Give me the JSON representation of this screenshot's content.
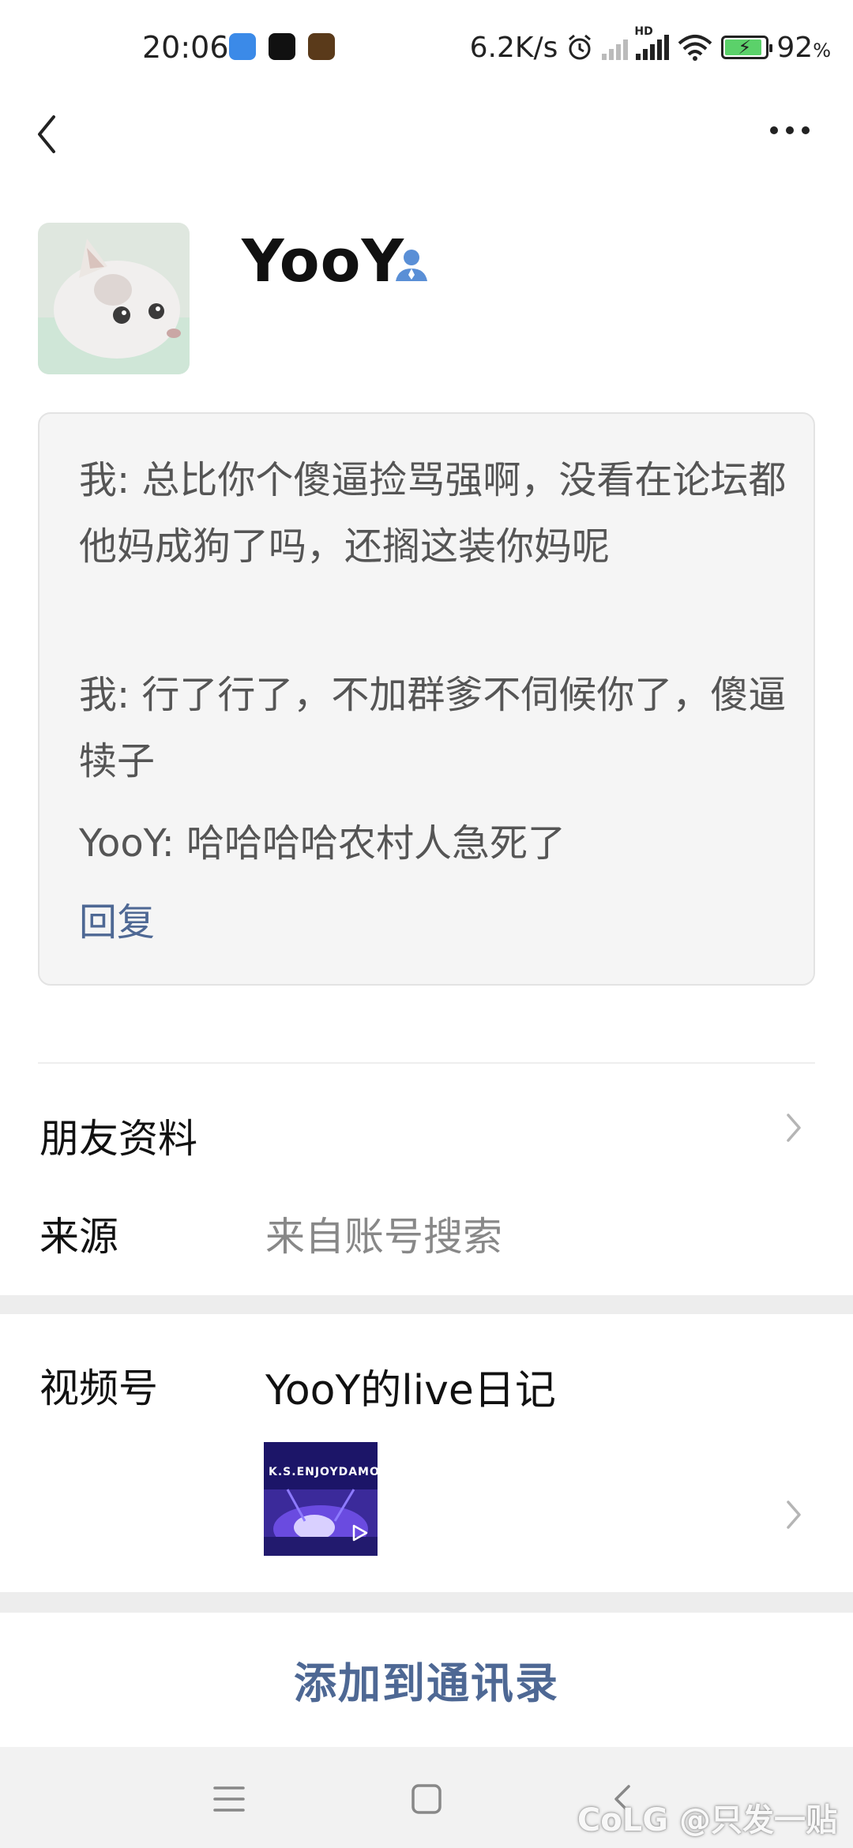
{
  "status_bar": {
    "time": "20:06",
    "network_speed": "6.2K/s",
    "network_label": "HD",
    "battery": "92",
    "battery_unit": "%"
  },
  "profile": {
    "name": "YooY"
  },
  "messages": [
    "我: 总比你个傻逼捡骂强啊，没看在论坛都他妈成狗了吗，还搁这装你妈呢",
    "我: 行了行了，不加群爹不伺候你了，傻逼犊子",
    "YooY: 哈哈哈哈农村人急死了"
  ],
  "reply_label": "回复",
  "friend_info": {
    "label": "朋友资料"
  },
  "source": {
    "label": "来源",
    "value": "来自账号搜索"
  },
  "channels": {
    "label": "视频号",
    "value": "YooY的live日记",
    "thumb_text": "K.S.ENJOYDAMONE"
  },
  "add_button": "添加到通讯录",
  "watermark": "CoLG @只发一贴",
  "colors": {
    "accent": "#4e6894",
    "gap": "#ededed",
    "message_bg": "#f5f5f5"
  }
}
